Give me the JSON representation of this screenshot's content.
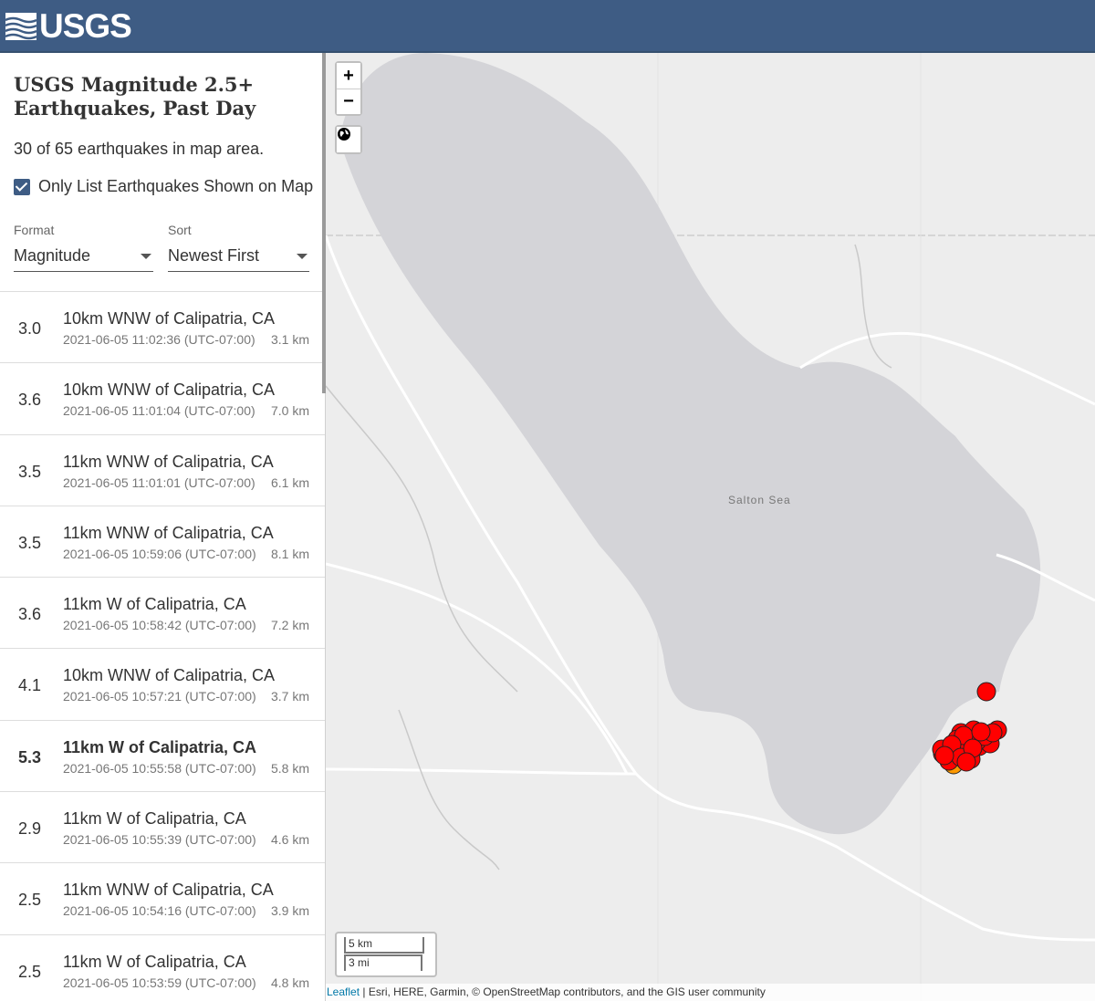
{
  "header": {
    "logo_text": "USGS"
  },
  "sidebar": {
    "title": "USGS Magnitude 2.5+ Earthquakes, Past Day",
    "count_text": "30 of 65 earthquakes in map area.",
    "only_list_label": "Only List Earthquakes Shown on Map",
    "only_list_checked": true,
    "format": {
      "label": "Format",
      "value": "Magnitude"
    },
    "sort": {
      "label": "Sort",
      "value": "Newest First"
    }
  },
  "quakes": [
    {
      "mag": "3.0",
      "place": "10km WNW of Calipatria, CA",
      "time": "2021-06-05 11:02:36 (UTC-07:00)",
      "depth": "3.1 km"
    },
    {
      "mag": "3.6",
      "place": "10km WNW of Calipatria, CA",
      "time": "2021-06-05 11:01:04 (UTC-07:00)",
      "depth": "7.0 km"
    },
    {
      "mag": "3.5",
      "place": "11km WNW of Calipatria, CA",
      "time": "2021-06-05 11:01:01 (UTC-07:00)",
      "depth": "6.1 km"
    },
    {
      "mag": "3.5",
      "place": "11km WNW of Calipatria, CA",
      "time": "2021-06-05 10:59:06 (UTC-07:00)",
      "depth": "8.1 km"
    },
    {
      "mag": "3.6",
      "place": "11km W of Calipatria, CA",
      "time": "2021-06-05 10:58:42 (UTC-07:00)",
      "depth": "7.2 km"
    },
    {
      "mag": "4.1",
      "place": "10km WNW of Calipatria, CA",
      "time": "2021-06-05 10:57:21 (UTC-07:00)",
      "depth": "3.7 km"
    },
    {
      "mag": "5.3",
      "place": "11km W of Calipatria, CA",
      "time": "2021-06-05 10:55:58 (UTC-07:00)",
      "depth": "5.8 km"
    },
    {
      "mag": "2.9",
      "place": "11km W of Calipatria, CA",
      "time": "2021-06-05 10:55:39 (UTC-07:00)",
      "depth": "4.6 km"
    },
    {
      "mag": "2.5",
      "place": "11km WNW of Calipatria, CA",
      "time": "2021-06-05 10:54:16 (UTC-07:00)",
      "depth": "3.9 km"
    },
    {
      "mag": "2.5",
      "place": "11km W of Calipatria, CA",
      "time": "2021-06-05 10:53:59 (UTC-07:00)",
      "depth": "4.8 km"
    }
  ],
  "map": {
    "zoom_in": "+",
    "zoom_out": "−",
    "lake_label": "Salton Sea",
    "scale_km": "5 km",
    "scale_mi": "3 mi",
    "attribution_link": "Leaflet",
    "attribution_text": " | Esri, HERE, Garmin, © OpenStreetMap contributors, and the GIS user community",
    "colors": {
      "quake_fill": "#ff0000",
      "quake_older": "#ff9900",
      "water": "#d2d2d6",
      "land": "#ededed",
      "road": "#ffffff"
    }
  }
}
